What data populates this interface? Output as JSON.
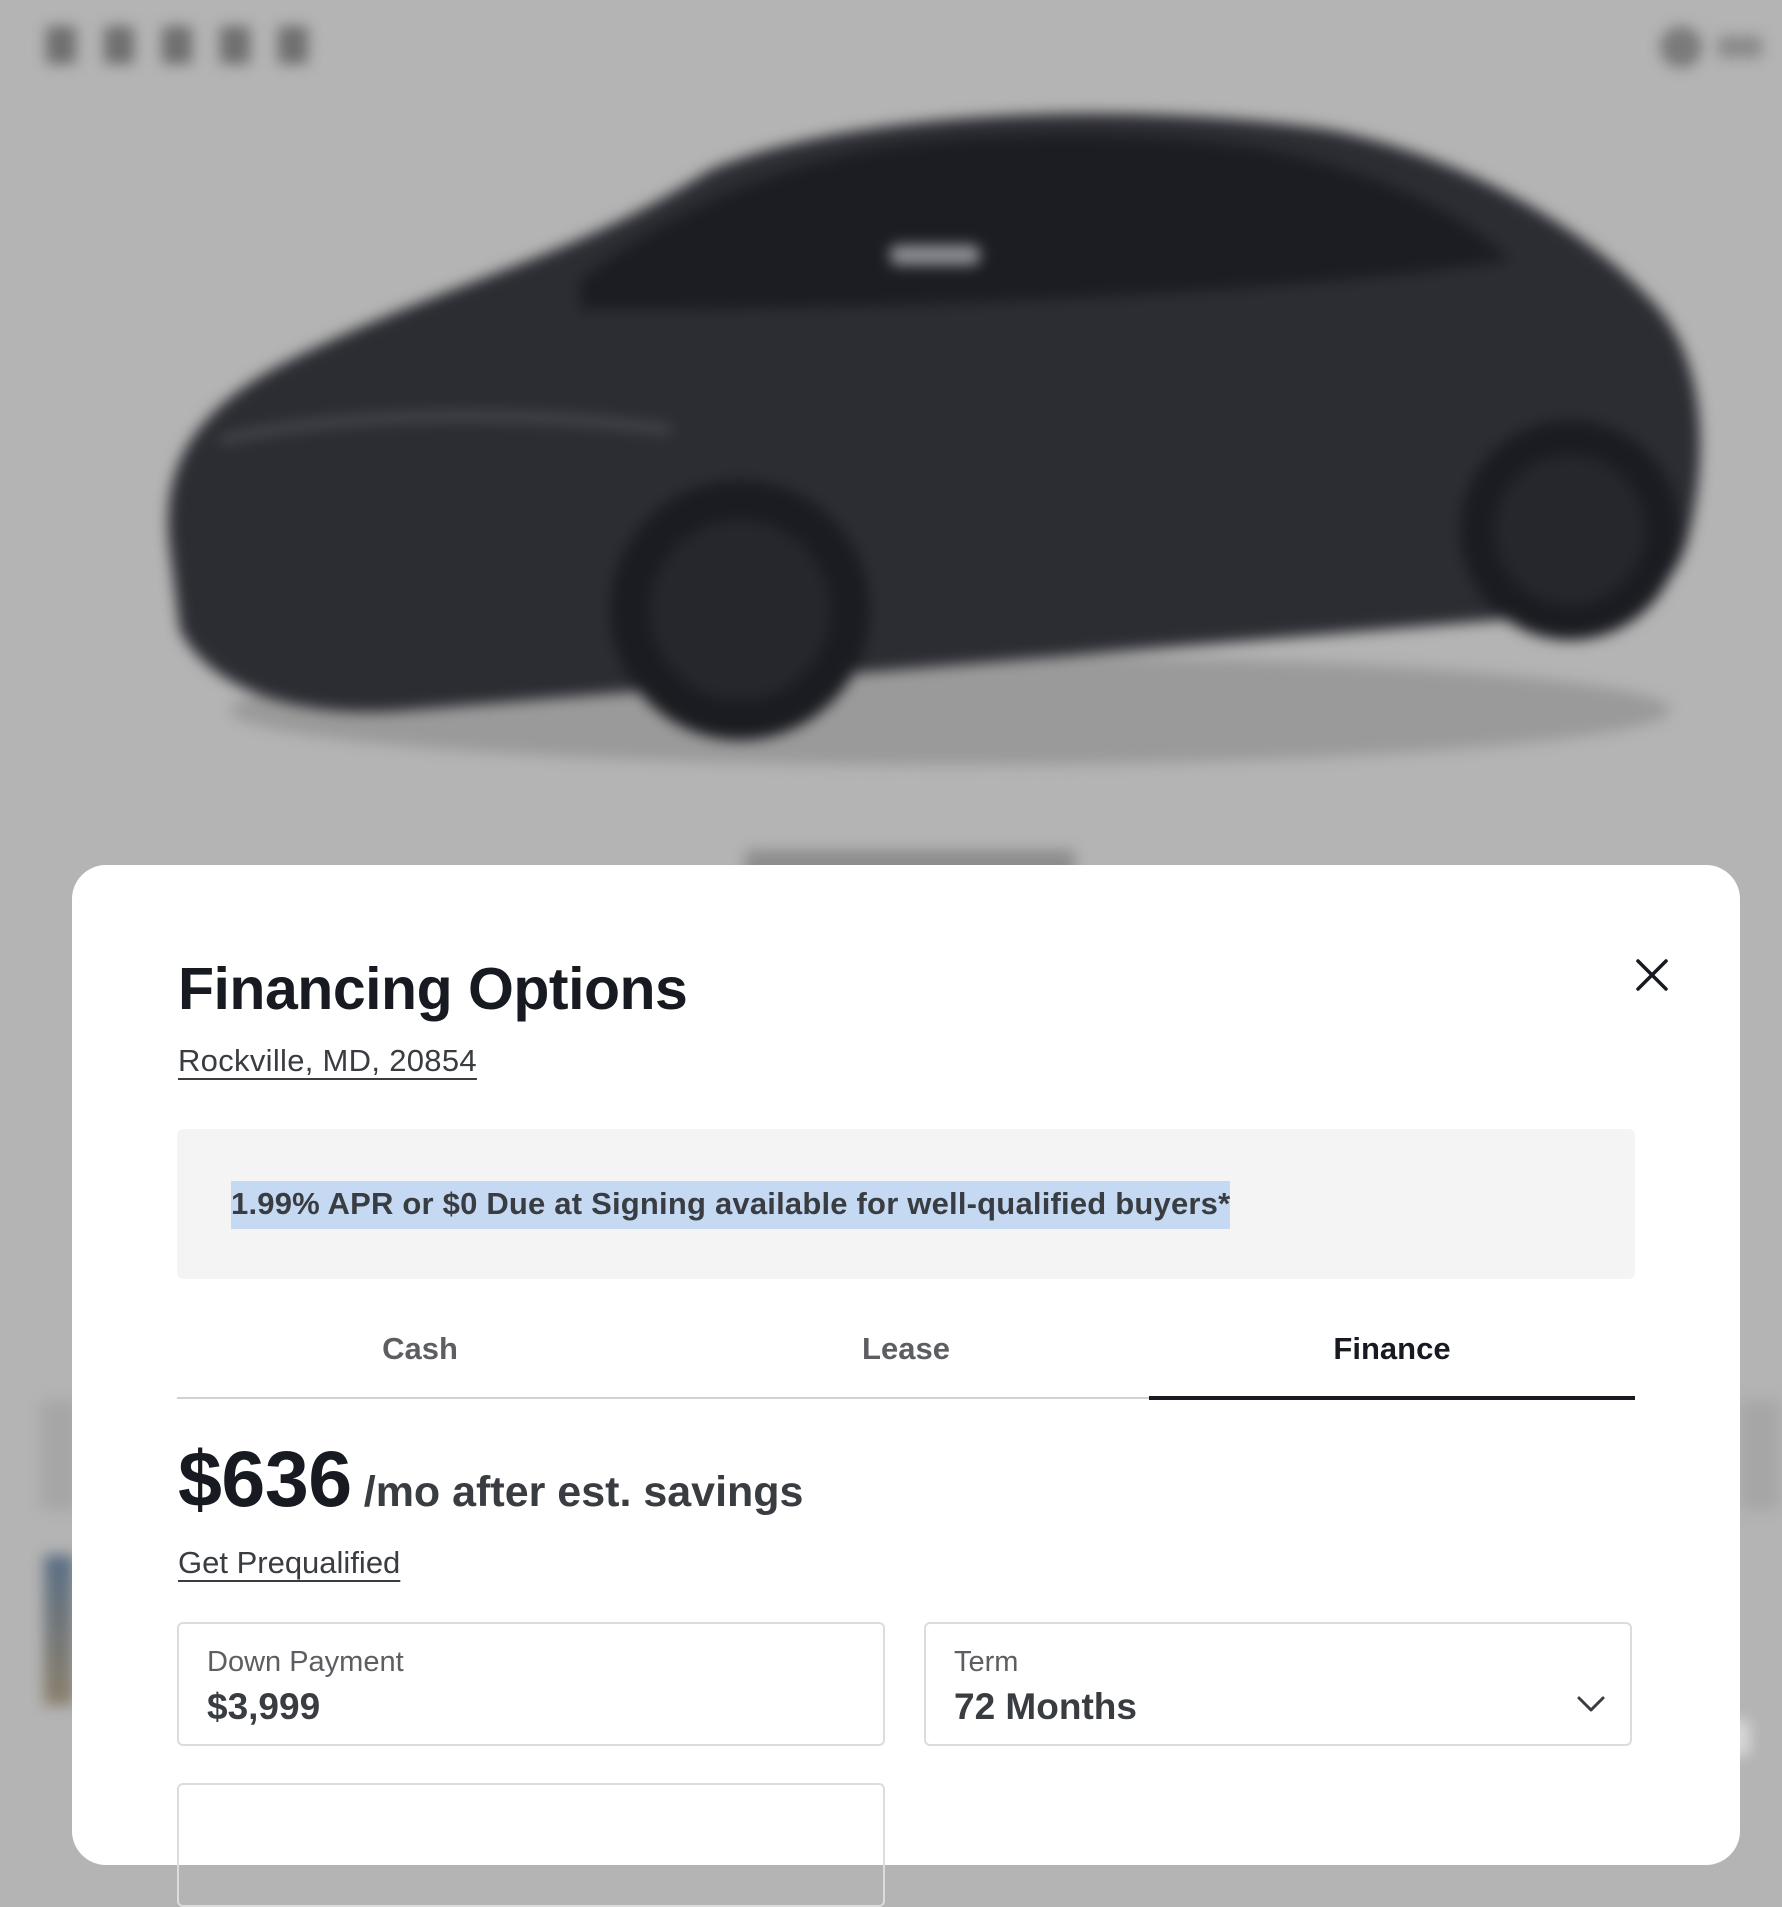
{
  "modal": {
    "title": "Financing Options",
    "location": "Rockville, MD, 20854",
    "promo": "1.99% APR or $0 Due at Signing available for well-qualified buyers*"
  },
  "tabs": [
    {
      "label": "Cash",
      "active": false
    },
    {
      "label": "Lease",
      "active": false
    },
    {
      "label": "Finance",
      "active": true
    }
  ],
  "payment": {
    "amount": "$636",
    "suffix": "/mo after est. savings",
    "prequalified_link": "Get Prequalified"
  },
  "fields": {
    "down_payment": {
      "label": "Down Payment",
      "value": "$3,999"
    },
    "term": {
      "label": "Term",
      "value": "72 Months"
    }
  },
  "icons": {
    "close": "close-icon",
    "term_dropdown": "chevron-down-icon"
  },
  "colors": {
    "text_primary": "#171a20",
    "text_secondary": "#393c41",
    "selection_highlight": "#c5d9f2",
    "backdrop": "#b4b4b4",
    "car_body": "#2c2d33"
  }
}
